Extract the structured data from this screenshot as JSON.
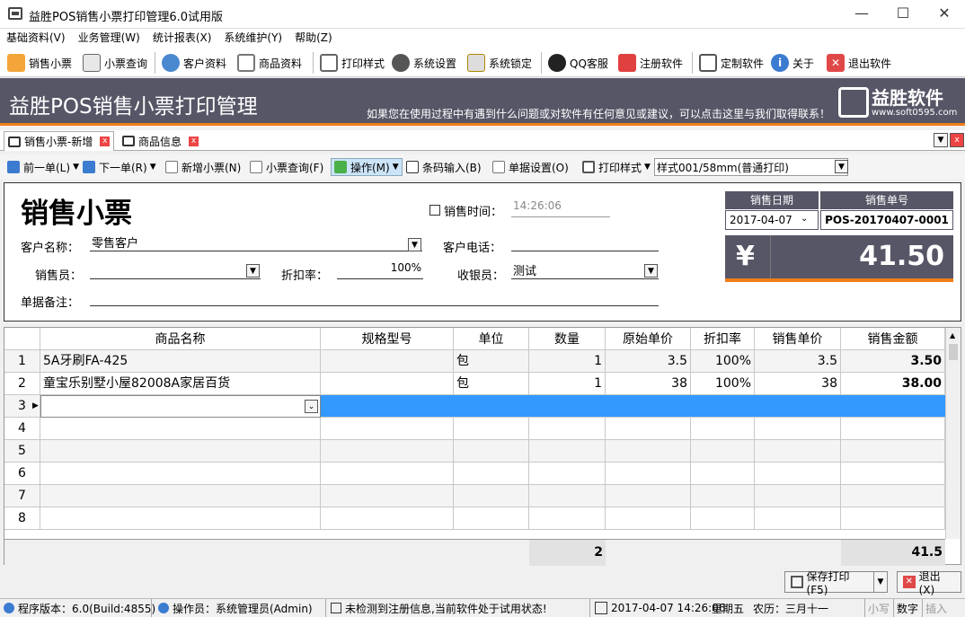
{
  "window": {
    "title": "益胜POS销售小票打印管理6.0试用版"
  },
  "menu": [
    "基础资料(V)",
    "业务管理(W)",
    "统计报表(X)",
    "系统维护(Y)",
    "帮助(Z)"
  ],
  "toolbar": {
    "sales_ticket": "销售小票",
    "ticket_query": "小票查询",
    "customer_info": "客户资料",
    "product_info": "商品资料",
    "print_style": "打印样式",
    "system_settings": "系统设置",
    "system_lock": "系统锁定",
    "qq_service": "QQ客服",
    "register_software": "注册软件",
    "custom_software": "定制软件",
    "about": "关于",
    "exit_software": "退出软件"
  },
  "banner": {
    "title": "益胜POS销售小票打印管理",
    "notice": "如果您在使用过程中有遇到什么问题或对软件有任何意见或建议，可以点击这里与我们取得联系！",
    "logo_name": "益胜软件",
    "logo_url": "www.soft0595.com"
  },
  "tabs": [
    "销售小票-新增",
    "商品信息"
  ],
  "subtoolbar": {
    "prev": "前一单(L)",
    "next": "下一单(R)",
    "new_ticket": "新增小票(N)",
    "query": "小票查询(F)",
    "operation": "操作(M)",
    "barcode": "条码输入(B)",
    "doc_settings": "单据设置(O)",
    "print_style": "打印样式",
    "style_value": "样式001/58mm(普通打印)"
  },
  "form": {
    "heading": "销售小票",
    "sale_time_label": "销售时间：",
    "sale_time_value": "14:26:06",
    "customer_name_label": "客户名称：",
    "customer_name_value": "零售客户",
    "customer_phone_label": "客户电话：",
    "customer_phone_value": "",
    "salesperson_label": "销售员：",
    "salesperson_value": "",
    "discount_label": "折扣率：",
    "discount_value": "100%",
    "cashier_label": "收银员：",
    "cashier_value": "测试",
    "remark_label": "单据备注：",
    "remark_value": "",
    "sale_date_label": "销售日期",
    "sale_date_value": "2017-04-07",
    "order_no_label": "销售单号",
    "order_no_value": "POS-20170407-0001",
    "currency_symbol": "¥",
    "total_amount": "41.50"
  },
  "grid": {
    "headers": [
      "商品名称",
      "规格型号",
      "单位",
      "数量",
      "原始单价",
      "折扣率",
      "销售单价",
      "销售金额"
    ],
    "rows": [
      {
        "no": "1",
        "name": "5A牙刷FA-425",
        "spec": "",
        "unit": "包",
        "qty": "1",
        "orig_price": "3.5",
        "discount": "100%",
        "sale_price": "3.5",
        "amount": "3.50"
      },
      {
        "no": "2",
        "name": "童宝乐别墅小屋82008A家居百货",
        "spec": "",
        "unit": "包",
        "qty": "1",
        "orig_price": "38",
        "discount": "100%",
        "sale_price": "38",
        "amount": "38.00"
      }
    ],
    "empty_rows": [
      "3",
      "4",
      "5",
      "6",
      "7",
      "8"
    ],
    "total_qty": "2",
    "total_amount": "41.5"
  },
  "buttons": {
    "save_print": "保存打印(F5)",
    "exit": "退出(X)"
  },
  "status": {
    "version": "程序版本：6.0(Build:4855)",
    "operator": "操作员：系统管理员(Admin)",
    "register": "未检测到注册信息,当前软件处于试用状态!",
    "datetime": "2017-04-07 14:26:06",
    "weekday": "星期五",
    "lunar": "农历：三月十一",
    "small_write": "小写",
    "numeric": "数字",
    "insert": "插入"
  },
  "colors": {
    "banner": "#565667",
    "accent": "#f07e18",
    "selection": "#3399ff"
  }
}
